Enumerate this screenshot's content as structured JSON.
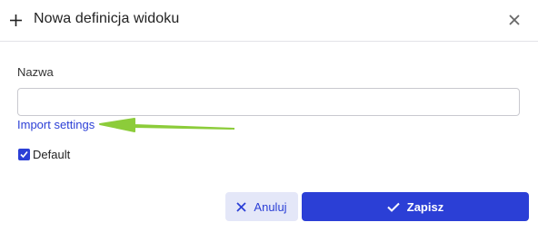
{
  "dialog": {
    "title": "Nowa definicja widoku",
    "plus_icon": "plus-icon",
    "close_icon": "close-icon"
  },
  "form": {
    "name_label": "Nazwa",
    "name_value": "",
    "import_link": "Import settings",
    "default_checkbox": {
      "label": "Default",
      "checked": true
    }
  },
  "buttons": {
    "cancel_label": "Anuluj",
    "cancel_icon": "x-icon",
    "save_label": "Zapisz",
    "save_icon": "check-icon"
  },
  "colors": {
    "accent": "#2b3fd6",
    "cancel_bg": "#e4e7f8",
    "annotation_arrow": "#8ccc3a"
  }
}
